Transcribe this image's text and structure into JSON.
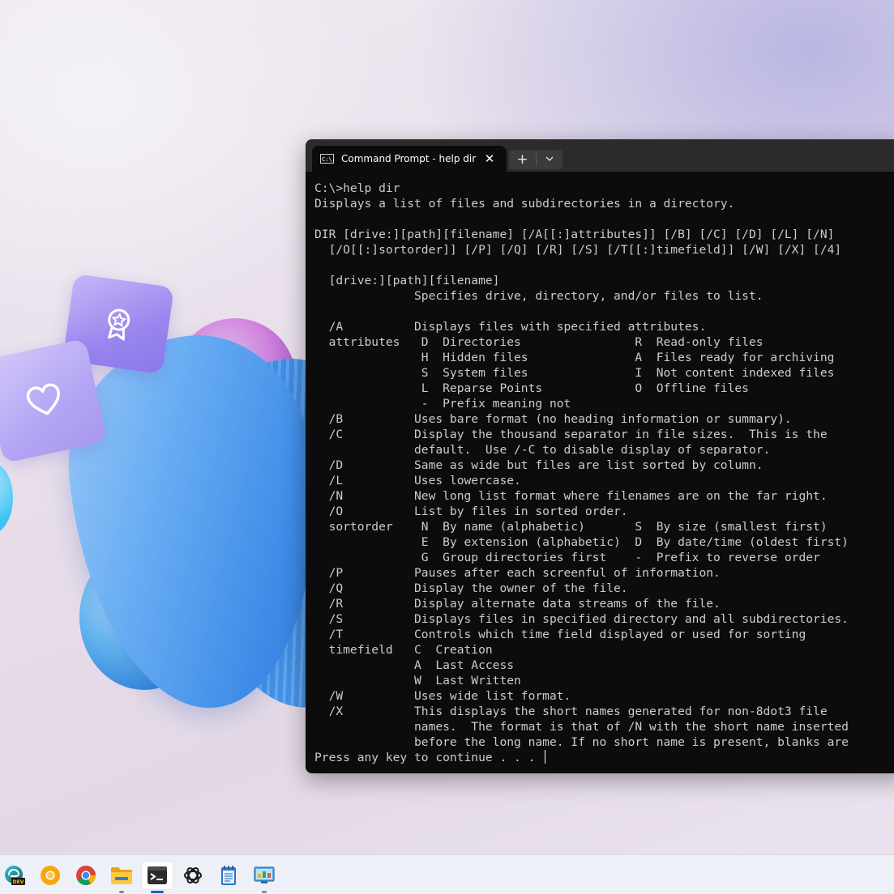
{
  "window": {
    "tab_title": "Command Prompt - help  dir",
    "tab_icon_text": "C:\\.",
    "close_glyph": "✕",
    "new_tab_glyph": "+",
    "dropdown_glyph": "⌄"
  },
  "console": {
    "lines": [
      "C:\\>help dir",
      "Displays a list of files and subdirectories in a directory.",
      "",
      "DIR [drive:][path][filename] [/A[[:]attributes]] [/B] [/C] [/D] [/L] [/N]",
      "  [/O[[:]sortorder]] [/P] [/Q] [/R] [/S] [/T[[:]timefield]] [/W] [/X] [/4]",
      "",
      "  [drive:][path][filename]",
      "              Specifies drive, directory, and/or files to list.",
      "",
      "  /A          Displays files with specified attributes.",
      "  attributes   D  Directories                R  Read-only files",
      "               H  Hidden files               A  Files ready for archiving",
      "               S  System files               I  Not content indexed files",
      "               L  Reparse Points             O  Offline files",
      "               -  Prefix meaning not",
      "  /B          Uses bare format (no heading information or summary).",
      "  /C          Display the thousand separator in file sizes.  This is the",
      "              default.  Use /-C to disable display of separator.",
      "  /D          Same as wide but files are list sorted by column.",
      "  /L          Uses lowercase.",
      "  /N          New long list format where filenames are on the far right.",
      "  /O          List by files in sorted order.",
      "  sortorder    N  By name (alphabetic)       S  By size (smallest first)",
      "               E  By extension (alphabetic)  D  By date/time (oldest first)",
      "               G  Group directories first    -  Prefix to reverse order",
      "  /P          Pauses after each screenful of information.",
      "  /Q          Display the owner of the file.",
      "  /R          Display alternate data streams of the file.",
      "  /S          Displays files in specified directory and all subdirectories.",
      "  /T          Controls which time field displayed or used for sorting",
      "  timefield   C  Creation",
      "              A  Last Access",
      "              W  Last Written",
      "  /W          Uses wide list format.",
      "  /X          This displays the short names generated for non-8dot3 file",
      "              names.  The format is that of /N with the short name inserted",
      "              before the long name. If no short name is present, blanks are"
    ],
    "prompt": "Press any key to continue . . . "
  },
  "taskbar": {
    "edge_badge": "DEV"
  },
  "colors": {
    "terminal_bg": "#0c0c0c",
    "terminal_text": "#cccccc",
    "accent": "#0067c0"
  },
  "icons": [
    "edge-dev-icon",
    "chrome-canary-icon",
    "chrome-icon",
    "file-explorer-icon",
    "terminal-icon",
    "chatgpt-icon",
    "notepad-icon",
    "control-panel-icon"
  ]
}
